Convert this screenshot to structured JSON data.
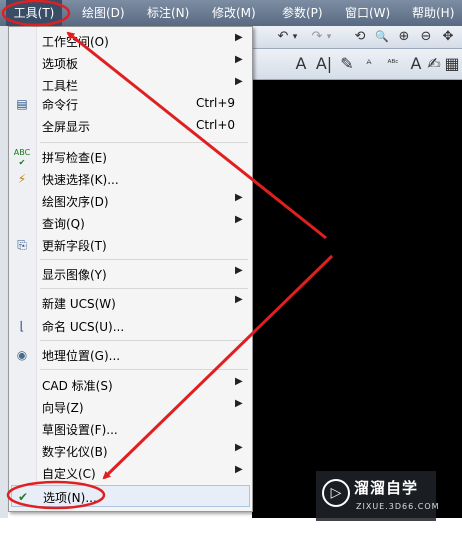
{
  "menubar": {
    "items": [
      {
        "label": "工具(T)"
      },
      {
        "label": "绘图(D)"
      },
      {
        "label": "标注(N)"
      },
      {
        "label": "修改(M)"
      },
      {
        "label": "参数(P)"
      },
      {
        "label": "窗口(W)"
      },
      {
        "label": "帮助(H)"
      }
    ]
  },
  "toolbar": {
    "row1": [
      "↶",
      "▾",
      "↷",
      "▾",
      "⟲",
      "🔍",
      "⊕",
      "⊖",
      "✥"
    ],
    "row2": [
      "A",
      "A|",
      "✎",
      "ᴬ",
      "ᴬᴮᶜ",
      "A",
      "✍",
      "▦"
    ]
  },
  "tools_menu": {
    "items": [
      {
        "label": "工作空间(O)",
        "shortcut": "",
        "submenu": true,
        "icon": ""
      },
      {
        "label": "选项板",
        "shortcut": "",
        "submenu": true,
        "icon": ""
      },
      {
        "label": "工具栏",
        "shortcut": "",
        "submenu": true,
        "icon": ""
      },
      {
        "label": "命令行",
        "shortcut": "Ctrl+9",
        "submenu": false,
        "icon": "command-line-icon"
      },
      {
        "label": "全屏显示",
        "shortcut": "Ctrl+0",
        "submenu": false,
        "icon": ""
      },
      {
        "label": "拼写检查(E)",
        "shortcut": "",
        "submenu": false,
        "icon": "spell-check-icon"
      },
      {
        "label": "快速选择(K)...",
        "shortcut": "",
        "submenu": false,
        "icon": "quick-select-icon"
      },
      {
        "label": "绘图次序(D)",
        "shortcut": "",
        "submenu": true,
        "icon": ""
      },
      {
        "label": "查询(Q)",
        "shortcut": "",
        "submenu": true,
        "icon": ""
      },
      {
        "label": "更新字段(T)",
        "shortcut": "",
        "submenu": false,
        "icon": "update-fields-icon"
      },
      {
        "label": "显示图像(Y)",
        "shortcut": "",
        "submenu": true,
        "icon": ""
      },
      {
        "label": "新建 UCS(W)",
        "shortcut": "",
        "submenu": true,
        "icon": ""
      },
      {
        "label": "命名 UCS(U)...",
        "shortcut": "",
        "submenu": false,
        "icon": "named-ucs-icon"
      },
      {
        "label": "地理位置(G)...",
        "shortcut": "",
        "submenu": false,
        "icon": "geolocation-icon"
      },
      {
        "label": "CAD 标准(S)",
        "shortcut": "",
        "submenu": true,
        "icon": ""
      },
      {
        "label": "向导(Z)",
        "shortcut": "",
        "submenu": true,
        "icon": ""
      },
      {
        "label": "草图设置(F)...",
        "shortcut": "",
        "submenu": false,
        "icon": ""
      },
      {
        "label": "数字化仪(B)",
        "shortcut": "",
        "submenu": true,
        "icon": ""
      },
      {
        "label": "自定义(C)",
        "shortcut": "",
        "submenu": true,
        "icon": ""
      },
      {
        "label": "选项(N)...",
        "shortcut": "",
        "submenu": false,
        "icon": "options-icon"
      }
    ]
  },
  "watermark": {
    "title": "溜溜自学",
    "url": "ZIXUE.3D66.COM"
  },
  "colors": {
    "menubar": "#586a82",
    "annotation": "#e02020",
    "menu_bg": "#f5f5f5",
    "canvas": "#000000"
  }
}
